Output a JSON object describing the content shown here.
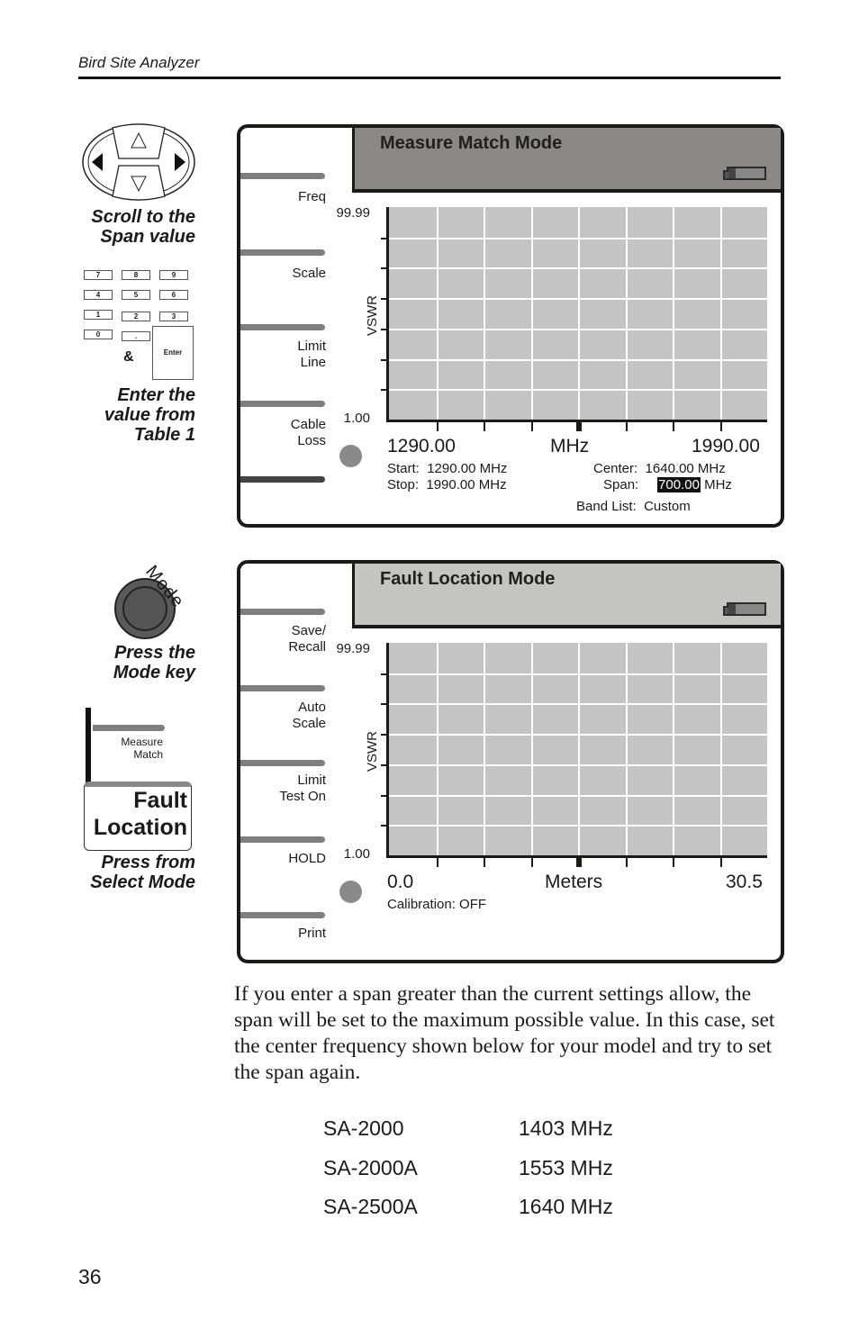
{
  "header": {
    "title": "Bird Site Analyzer"
  },
  "sidebar": {
    "captions": [
      {
        "lines": [
          "Scroll to the",
          "Span value"
        ]
      },
      {
        "lines": [
          "Enter the",
          "value from",
          "Table 1"
        ]
      },
      {
        "lines": [
          "Press the",
          "Mode key"
        ]
      },
      {
        "lines": [
          "Press from",
          "Select Mode"
        ]
      }
    ],
    "keypad": {
      "keys": [
        "7",
        "8",
        "9",
        "4",
        "5",
        "6",
        "1",
        "2",
        "3",
        "0",
        "."
      ],
      "ampersand": "&",
      "enter_label": "Enter"
    },
    "mode_key_label": "Mode",
    "select_mode": {
      "previous": [
        "Measure",
        "Match"
      ],
      "selected": [
        "Fault",
        "Location"
      ]
    }
  },
  "screens": [
    {
      "title": "Measure Match Mode",
      "softkeys": [
        {
          "lines": [
            "Freq"
          ]
        },
        {
          "lines": [
            "Scale"
          ]
        },
        {
          "lines": [
            "Limit",
            "Line"
          ]
        },
        {
          "lines": [
            "Cable",
            "Loss"
          ]
        }
      ],
      "y_axis": {
        "title": "VSWR",
        "max": "99.99",
        "min": "1.00"
      },
      "x_axis": {
        "start": "1290.00",
        "unit": "MHz",
        "stop": "1990.00"
      },
      "info": {
        "start_label": "Start:",
        "start_value": "1290.00 MHz",
        "stop_label": "Stop:",
        "stop_value": "1990.00 MHz",
        "center_label": "Center:",
        "center_value": "1640.00 MHz",
        "span_label": "Span:",
        "span_value": "700.00",
        "span_unit": "MHz",
        "band_label": "Band List:",
        "band_value": "Custom"
      }
    },
    {
      "title": "Fault Location Mode",
      "softkeys": [
        {
          "lines": [
            "Save/",
            "Recall"
          ]
        },
        {
          "lines": [
            "Auto",
            "Scale"
          ]
        },
        {
          "lines": [
            "Limit",
            "Test On"
          ]
        },
        {
          "lines": [
            "HOLD"
          ]
        },
        {
          "lines": [
            "Print"
          ]
        }
      ],
      "y_axis": {
        "title": "VSWR",
        "max": "99.99",
        "min": "1.00"
      },
      "x_axis": {
        "start": "0.0",
        "unit": "Meters",
        "stop": "30.5"
      },
      "info": {
        "calibration": "Calibration: OFF"
      }
    }
  ],
  "body": {
    "paragraph": "If you enter a span greater than the current settings allow, the span will be set to the maximum possible value. In this case, set the center frequency shown below for your model and try to set the span again."
  },
  "models_table": [
    {
      "model": "SA-2000",
      "center": "1403 MHz"
    },
    {
      "model": "SA-2000A",
      "center": "1553 MHz"
    },
    {
      "model": "SA-2500A",
      "center": "1640 MHz"
    }
  ],
  "page_number": "36",
  "colors": {
    "screen_header_1": "#8a8987",
    "screen_header_2": "#c4c4c2",
    "plot_bg": "#c4c4c4",
    "softkey_bar": "#7f7f7f"
  }
}
